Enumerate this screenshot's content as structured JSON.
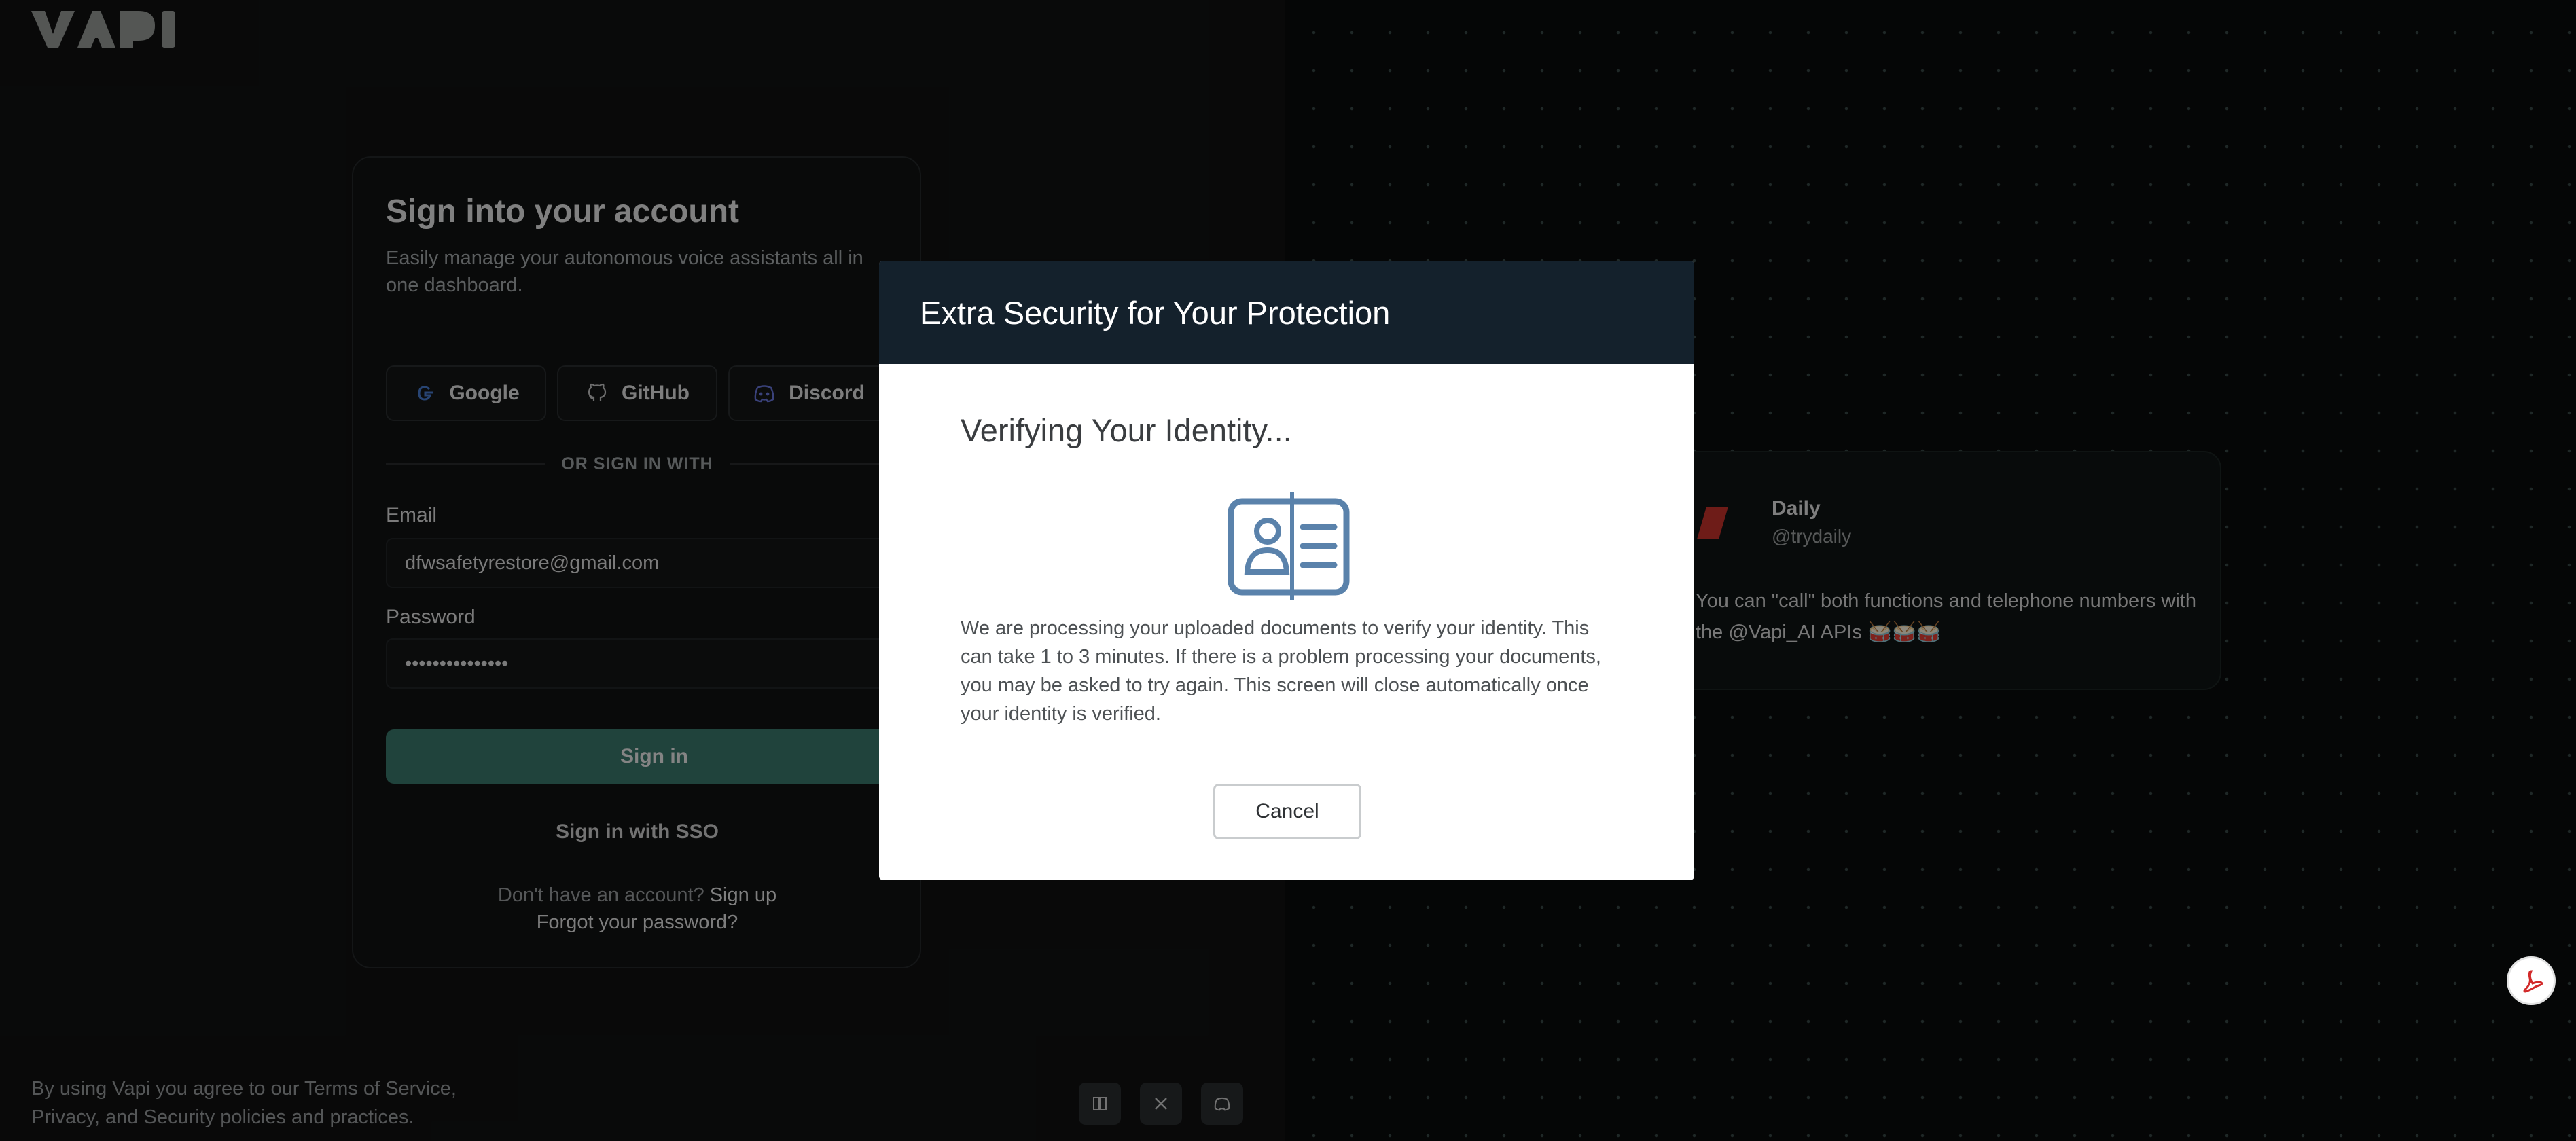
{
  "brand": {
    "logo_text": "VAPI"
  },
  "signin": {
    "title": "Sign into your account",
    "subtitle": "Easily manage your autonomous voice assistants all in one dashboard.",
    "oauth": [
      {
        "label": "Google",
        "icon": "google-icon"
      },
      {
        "label": "GitHub",
        "icon": "github-icon"
      },
      {
        "label": "Discord",
        "icon": "discord-icon"
      }
    ],
    "divider_text": "OR SIGN IN WITH",
    "email_label": "Email",
    "email_value": "dfwsafetyrestore@gmail.com",
    "password_label": "Password",
    "password_value": "•••••••••••••••",
    "signin_button": "Sign in",
    "sso_link": "Sign in with SSO",
    "no_account_text": "Don't have an account?",
    "signup_link": "Sign up",
    "forgot_link": "Forgot your password?"
  },
  "footer": {
    "terms": "By using Vapi you agree to our Terms of Service, Privacy, and Security policies and practices.",
    "socials": [
      "docs-icon",
      "x-icon",
      "discord-icon"
    ]
  },
  "testimonial": {
    "name": "Daily",
    "handle": "@trydaily",
    "text": "You can \"call\" both functions and telephone numbers with the @Vapi_AI APIs 🥁🥁🥁"
  },
  "modal": {
    "header": "Extra Security for Your Protection",
    "title": "Verifying Your Identity...",
    "body": "We are processing your uploaded documents to verify your identity. This can take 1 to 3 minutes. If there is a problem processing your documents, you may be asked to try again. This screen will close automatically once your identity is verified.",
    "cancel_button": "Cancel",
    "icon": "id-card-icon"
  },
  "colors": {
    "accent_green": "#3b7b6d",
    "modal_header": "#14212c",
    "id_icon": "#5a82ab"
  }
}
